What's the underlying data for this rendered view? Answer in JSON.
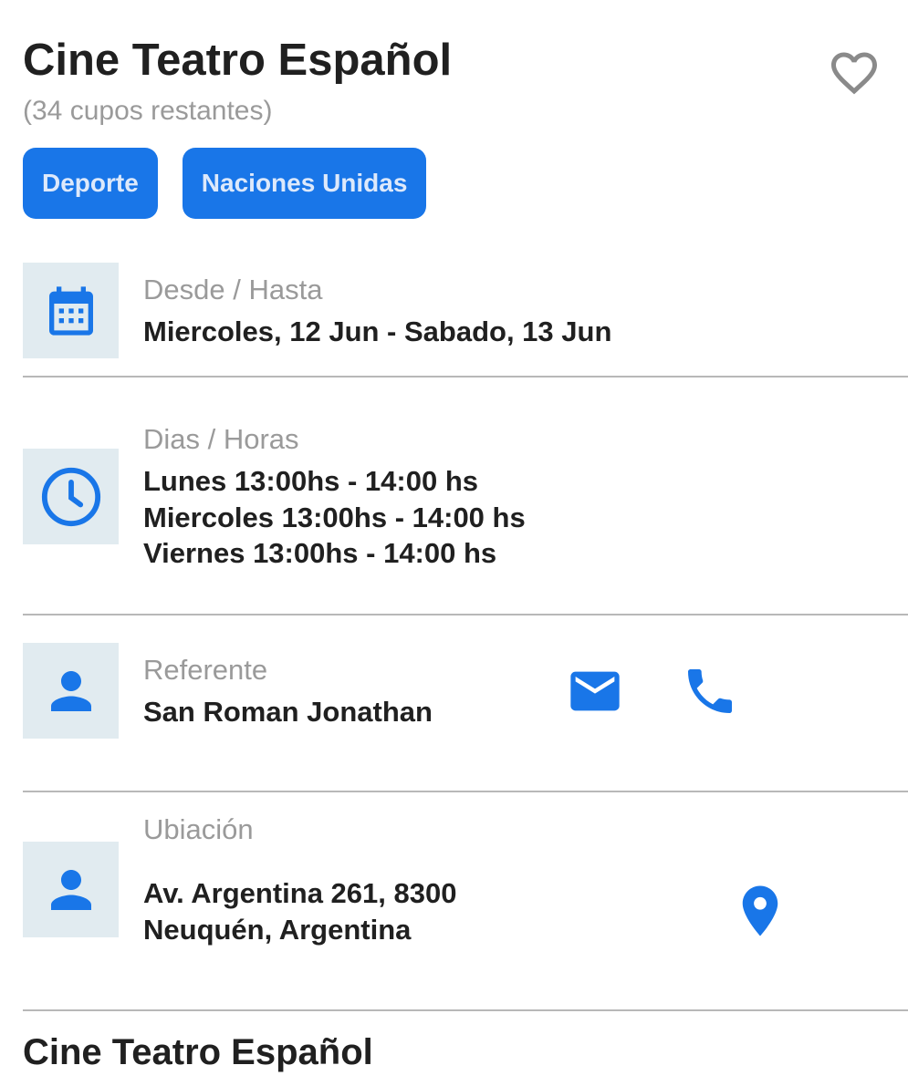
{
  "header": {
    "title": "Cine Teatro Español",
    "subtitle": "(34 cupos restantes)",
    "favorite_icon": "heart-outline-icon"
  },
  "tags": [
    "Deporte",
    "Naciones Unidas"
  ],
  "dates": {
    "icon": "calendar-icon",
    "label": "Desde / Hasta",
    "value": "Miercoles, 12 Jun - Sabado, 13 Jun"
  },
  "schedule": {
    "icon": "clock-icon",
    "label": "Dias / Horas",
    "lines": [
      "Lunes 13:00hs - 14:00 hs",
      "Miercoles 13:00hs - 14:00 hs",
      "Viernes 13:00hs - 14:00 hs"
    ]
  },
  "contact": {
    "icon": "person-icon",
    "label": "Referente",
    "value": "San Roman Jonathan",
    "email_icon": "email-icon",
    "phone_icon": "phone-icon"
  },
  "location": {
    "icon": "person-icon",
    "label": "Ubiación",
    "lines": [
      "Av. Argentina 261, 8300",
      "Neuquén, Argentina"
    ],
    "map_icon": "map-pin-icon"
  },
  "footer": {
    "title": "Cine Teatro Español"
  },
  "colors": {
    "accent": "#1976e8",
    "icon_bg": "#e1ebf0",
    "muted_text": "#9a9a9a",
    "divider": "#b8b8b8"
  }
}
